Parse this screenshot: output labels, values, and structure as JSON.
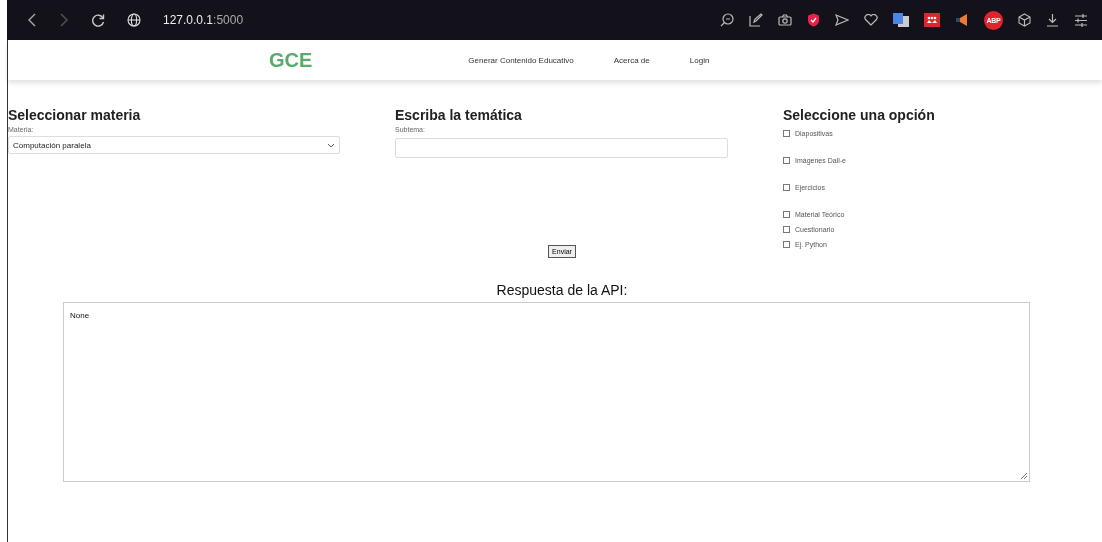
{
  "browser": {
    "url_host": "127.0.0.1",
    "url_port": ":5000",
    "extension_badge": "ABP"
  },
  "navbar": {
    "brand": "GCE",
    "links": [
      "Generar Contenido Educativo",
      "Acerca de",
      "Login"
    ]
  },
  "materia": {
    "heading": "Seleccionar materia",
    "label": "Materia:",
    "value": "Computación paralela"
  },
  "tematica": {
    "heading": "Escriba la temática",
    "label": "Subtema:"
  },
  "opciones": {
    "heading": "Seleccione una opción",
    "items": [
      {
        "label": "Diapositivas",
        "checked": false
      },
      {
        "label": "Imágenes Dall-e",
        "checked": false
      },
      {
        "label": "Ejercicios",
        "checked": false
      },
      {
        "label": "Material Teórico",
        "checked": false
      },
      {
        "label": "Cuestionario",
        "checked": false
      },
      {
        "label": "Ej. Python",
        "checked": false
      }
    ]
  },
  "submit": "Enviar",
  "response": {
    "heading": "Respuesta de la API:",
    "value": "None"
  }
}
